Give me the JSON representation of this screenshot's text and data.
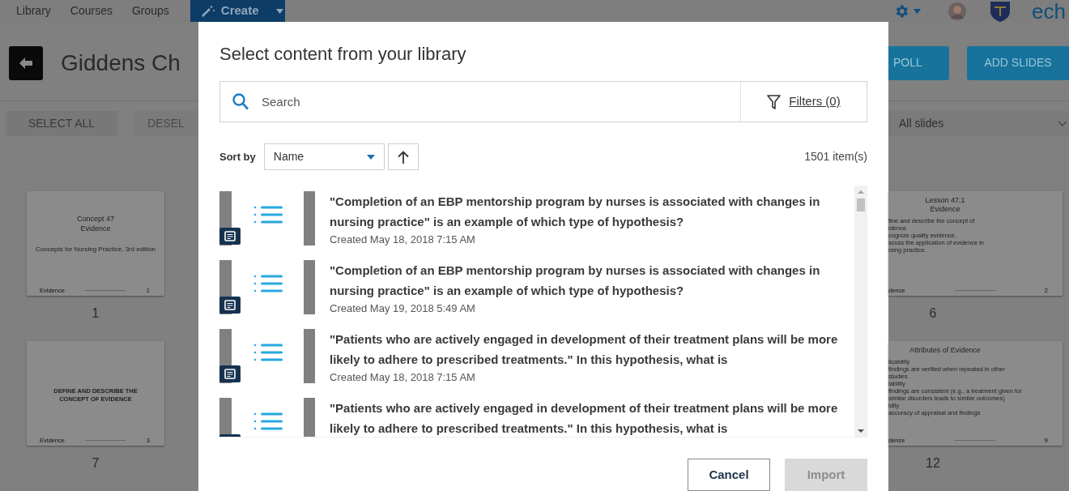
{
  "nav": {
    "links": [
      {
        "label": "Library"
      },
      {
        "label": "Courses"
      },
      {
        "label": "Groups"
      }
    ],
    "create": "Create",
    "logo": "ech"
  },
  "presentation": {
    "title": "Giddens Ch",
    "actions": [
      {
        "label": "POLL"
      },
      {
        "label": "ADD SLIDES"
      }
    ],
    "select_all": "SELECT ALL",
    "deselect": "DESEL",
    "filter": "All slides"
  },
  "slides_left": [
    {
      "number": "1",
      "kind": "title",
      "title": [
        "Concept 47",
        "Evidence"
      ],
      "subtitle": "Concepts for Nursing Practice, 3rd edition",
      "footer": "Evidence",
      "page": "1"
    },
    {
      "number": "7",
      "kind": "heading",
      "title": [
        "DEFINE AND DESCRIBE THE",
        "CONCEPT OF EVIDENCE"
      ],
      "footer": "Evidence",
      "page": "3"
    }
  ],
  "slides_right": [
    {
      "number": "6",
      "kind": "bullets",
      "title": [
        "Lesson 47.1",
        "Evidence"
      ],
      "bullets": [
        "fine and describe the concept of",
        "idence",
        "cognize quality evidence.",
        "scuss the application of evidence in",
        "rsing practice."
      ],
      "footer": "dence",
      "page": "2"
    },
    {
      "number": "12",
      "kind": "bullets",
      "title": [
        "Attributes of Evidence"
      ],
      "bullets": [
        "licability",
        "findings are verified when repeated in other",
        "studies",
        "iability",
        "findings are consistent (e.g., a treatment given for",
        "similar disorders leads to similar outcomes)",
        "idity",
        "accuracy of appraisal and findings"
      ],
      "footer": "dence",
      "page": "9"
    }
  ],
  "modal": {
    "title": "Select content from your library",
    "search": {
      "placeholder": "Search"
    },
    "filters": "Filters (0)",
    "sort_label": "Sort by",
    "sort_value": "Name",
    "count": "1501 item(s)",
    "items": [
      {
        "kind": "multiple_choice",
        "text": "\"Completion of an EBP mentorship program by nurses is associated with changes in nursing practice\" is an example of which type of hypothesis?",
        "created": "Created May 18, 2018 7:15 AM"
      },
      {
        "kind": "multiple_choice",
        "text": "\"Completion of an EBP mentorship program by nurses is associated with changes in nursing practice\" is an example of which type of hypothesis?",
        "created": "Created May 19, 2018 5:49 AM"
      },
      {
        "kind": "multiple_choice",
        "text": "\"Patients who are actively engaged in development of their treatment plans will be more likely to adhere to prescribed treatments.\" In this hypothesis, what is",
        "created": "Created May 18, 2018 7:15 AM"
      },
      {
        "kind": "multiple_choice",
        "text": "\"Patients who are actively engaged in development of their treatment plans will be more likely to adhere to prescribed treatments.\" In this hypothesis, what is"
      }
    ],
    "buttons": [
      {
        "label": "Cancel",
        "disabled": false
      },
      {
        "label": "Import",
        "disabled": true
      }
    ]
  }
}
